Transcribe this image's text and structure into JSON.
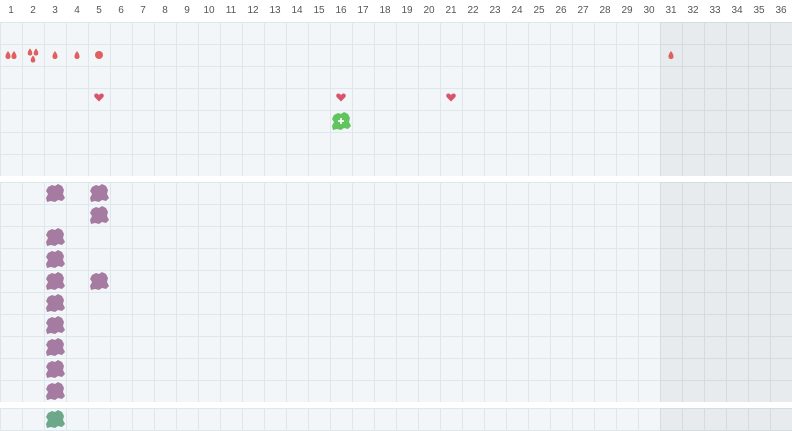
{
  "calendar": {
    "days": [
      "1",
      "2",
      "3",
      "4",
      "5",
      "6",
      "7",
      "8",
      "9",
      "10",
      "11",
      "12",
      "13",
      "14",
      "15",
      "16",
      "17",
      "18",
      "19",
      "20",
      "21",
      "22",
      "23",
      "24",
      "25",
      "26",
      "27",
      "28",
      "29",
      "30",
      "31",
      "32",
      "33",
      "34",
      "35",
      "36"
    ],
    "shaded_from_day": 31,
    "colors": {
      "grid_bg": "#f2f6f8",
      "grid_line": "#dde7ec",
      "drop": "#e06060",
      "heart": "#d9536a",
      "green_blob": "#62c45f",
      "purple_blob": "#a57ba1",
      "teal_blob": "#6da88a"
    },
    "top_markers": [
      {
        "day": 1,
        "row": 1,
        "icon": "double-drop-icon"
      },
      {
        "day": 2,
        "row": 1,
        "icon": "triple-drop-icon"
      },
      {
        "day": 3,
        "row": 1,
        "icon": "drop-icon"
      },
      {
        "day": 4,
        "row": 1,
        "icon": "drop-icon"
      },
      {
        "day": 5,
        "row": 1,
        "icon": "dot-icon"
      },
      {
        "day": 31,
        "row": 1,
        "icon": "drop-icon"
      },
      {
        "day": 5,
        "row": 3,
        "icon": "heart-icon"
      },
      {
        "day": 16,
        "row": 3,
        "icon": "heart-icon"
      },
      {
        "day": 21,
        "row": 3,
        "icon": "heart-icon"
      },
      {
        "day": 16,
        "row": 4,
        "icon": "green-plus-blob-icon"
      }
    ],
    "middle_markers": [
      {
        "day": 3,
        "row": 0
      },
      {
        "day": 5,
        "row": 0
      },
      {
        "day": 5,
        "row": 1
      },
      {
        "day": 3,
        "row": 2
      },
      {
        "day": 3,
        "row": 3
      },
      {
        "day": 3,
        "row": 4
      },
      {
        "day": 5,
        "row": 4
      },
      {
        "day": 3,
        "row": 5
      },
      {
        "day": 3,
        "row": 6
      },
      {
        "day": 3,
        "row": 7
      },
      {
        "day": 3,
        "row": 8
      },
      {
        "day": 3,
        "row": 9
      }
    ],
    "bottom_markers": [
      {
        "day": 3,
        "row": 0
      }
    ]
  }
}
